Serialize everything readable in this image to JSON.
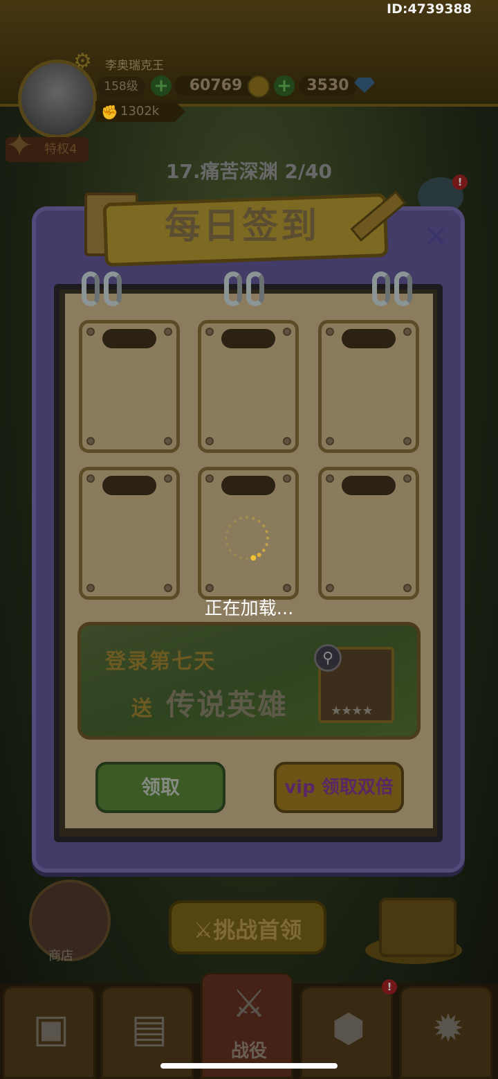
{
  "top_bar": {
    "id_label": "ID:4739388",
    "player_name": "李奥瑞克王",
    "level": "158级",
    "gold": "60769",
    "gems": "3530",
    "power": "1302k",
    "privilege": "特权4"
  },
  "stage": {
    "title": "17.痛苦深渊 2/40"
  },
  "dialog": {
    "title": "每日签到",
    "reward_line1": "登录第七天",
    "reward_line2_prefix": "送",
    "reward_line2_main": "传说英雄",
    "hero_stars": "★★★★",
    "claim_label": "领取",
    "vip_label": "vip 领取双倍",
    "loading": "正在加载..."
  },
  "main": {
    "shop_label": "商店",
    "boss_label": "挑战首领"
  },
  "bottom_nav": {
    "active_label": "战役"
  },
  "colors": {
    "dialog_frame": "#433b68",
    "accent_gold": "#7d6a22",
    "claim_green": "#3c5a24",
    "spinner": "#f2c230"
  },
  "icons": [
    "gear-icon",
    "plus-icon",
    "coin-icon",
    "gem-icon",
    "power-icon",
    "crown-icon",
    "close-icon",
    "sword-icon",
    "magnifier-icon",
    "chest-icon",
    "cards-icon",
    "shield-icon",
    "guild-icon"
  ]
}
